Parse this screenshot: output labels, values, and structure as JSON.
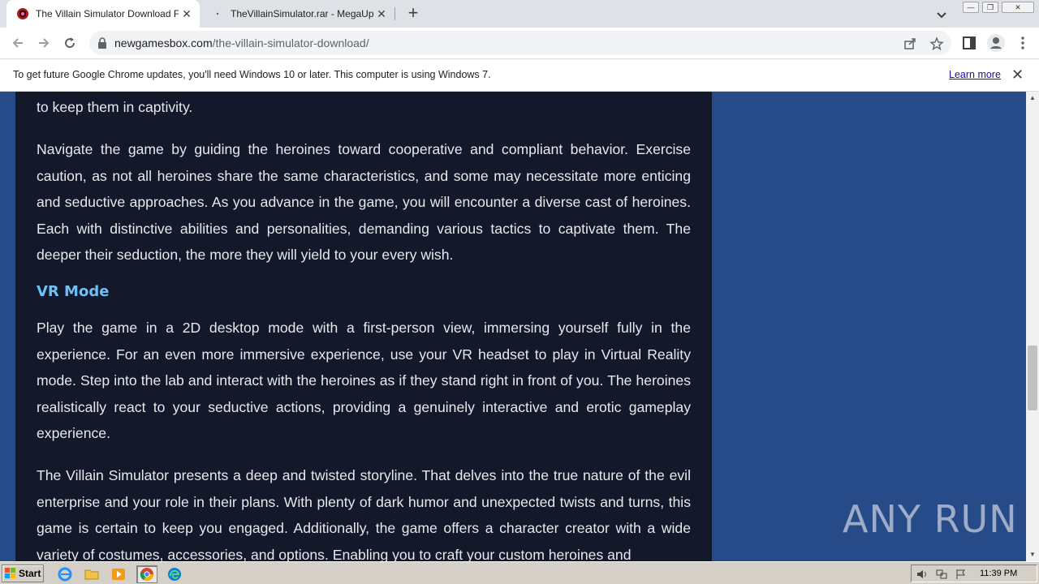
{
  "browser": {
    "tabs": [
      {
        "title": "The Villain Simulator Download Free (",
        "active": true
      },
      {
        "title": "TheVillainSimulator.rar - MegaUp",
        "active": false
      }
    ],
    "url_domain": "newgamesbox.com",
    "url_path": "/the-villain-simulator-download/"
  },
  "infobar": {
    "message": "To get future Google Chrome updates, you'll need Windows 10 or later. This computer is using Windows 7.",
    "link": "Learn more"
  },
  "article": {
    "p0": "to keep them in captivity.",
    "p1": "Navigate the game by guiding the heroines toward cooperative and compliant behavior. Exercise caution, as not all heroines share the same characteristics, and some may necessitate more enticing and seductive approaches. As you advance in the game, you will encounter a diverse cast of heroines. Each with distinctive abilities and personalities, demanding various tactics to captivate them. The deeper their seduction, the more they will yield to your every wish.",
    "heading_vr": "VR Mode",
    "p2": "Play the game in a 2D desktop mode with a first-person view, immersing yourself fully in the experience. For an even more immersive experience, use your VR headset to play in Virtual Reality mode. Step into the lab and interact with the heroines as if they stand right in front of you. The heroines realistically react to your seductive actions, providing a genuinely interactive and erotic gameplay experience.",
    "p3": "The Villain Simulator presents a deep and twisted storyline. That delves into the true nature of the evil enterprise and your role in their plans. With plenty of dark humor and unexpected twists and turns, this game is certain to keep you engaged. Additionally, the game offers a character creator with a wide variety of costumes, accessories, and options. Enabling you to craft your custom heroines and"
  },
  "watermark": "ANY RUN",
  "taskbar": {
    "start_label": "Start",
    "clock": "11:39 PM"
  },
  "colors": {
    "page_bg": "#274b88",
    "article_bg": "#13182a",
    "heading": "#6ec1f5"
  }
}
